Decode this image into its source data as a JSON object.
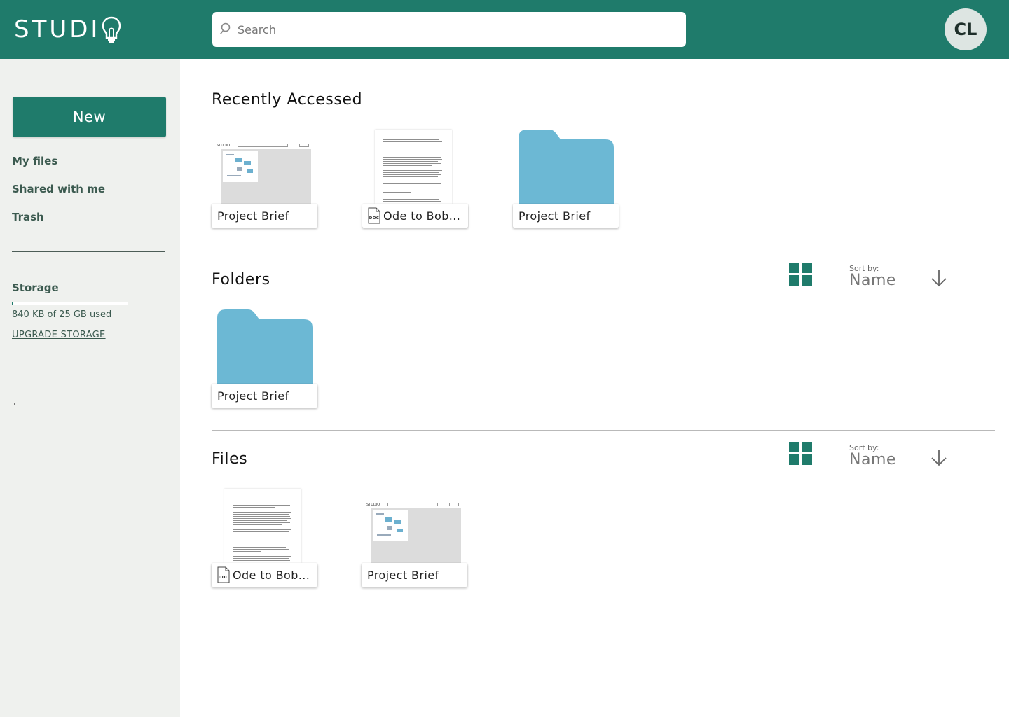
{
  "app": {
    "logo_text": "STUDI",
    "logo_icon": "lightbulb-icon",
    "accent_color": "#1f7b6b",
    "folder_color": "#6cb8d4"
  },
  "header": {
    "search_placeholder": "Search",
    "avatar_initials": "CL"
  },
  "sidebar": {
    "new_label": "New",
    "nav": [
      {
        "label": "My files"
      },
      {
        "label": "Shared with me"
      },
      {
        "label": "Trash"
      }
    ],
    "storage": {
      "title": "Storage",
      "used_text": "840 KB of 25 GB used",
      "used_fraction": 3.36e-05,
      "upgrade_label": "UPGRADE STORAGE"
    }
  },
  "recent": {
    "title": "Recently Accessed",
    "items": [
      {
        "name": "Project Brief",
        "kind": "screenshot",
        "thumb_text": "STUDIO"
      },
      {
        "name": "Ode to Bob...",
        "kind": "doc",
        "badge": "DOC"
      },
      {
        "name": "Project Brief",
        "kind": "folder"
      }
    ]
  },
  "folders": {
    "title": "Folders",
    "sort_caption": "Sort by:",
    "sort_value": "Name",
    "items": [
      {
        "name": "Project Brief",
        "kind": "folder"
      }
    ]
  },
  "files": {
    "title": "Files",
    "sort_caption": "Sort by:",
    "sort_value": "Name",
    "items": [
      {
        "name": "Ode to Bob...",
        "kind": "doc",
        "badge": "DOC"
      },
      {
        "name": "Project Brief",
        "kind": "screenshot",
        "thumb_text": "STUDIO"
      }
    ]
  }
}
